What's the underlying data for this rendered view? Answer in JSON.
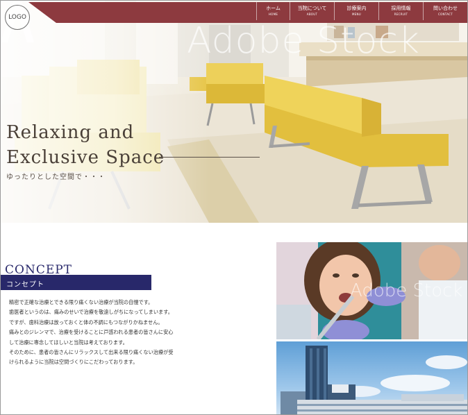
{
  "logo": {
    "text": "LOGO"
  },
  "nav": {
    "items": [
      {
        "jp": "ホーム",
        "en": "HOME"
      },
      {
        "jp": "当院について",
        "en": "ABOUT"
      },
      {
        "jp": "診療案内",
        "en": "MENU"
      },
      {
        "jp": "採用情報",
        "en": "RECRUIT"
      },
      {
        "jp": "問い合わせ",
        "en": "CONTACT"
      }
    ]
  },
  "hero": {
    "title_line1": "Relaxing and",
    "title_line2": "Exclusive Space",
    "subtitle": "ゆったりとした空間で・・・",
    "watermark": "Adobe Stock"
  },
  "concept": {
    "title": "CONCEPT",
    "label": "コンセプト",
    "paragraphs": [
      "精密で正確な治療とできる限り痛くない治療が当院の自慢です。",
      "歯医者というのは、痛みのせいで治療を敬遠しがちになってしまいます。",
      "ですが、歯科治療は放っておくと体の不調にもつながりかねません。",
      "痛みとのジレンマで、治療を受けることに戸惑われる患者の皆さんに安心",
      "して治療に専念してほしいと当院は考えております。",
      "そのために、患者の皆さんにリラックスして出来る限り痛くない治療が受",
      "けられるように当院は空間づくりにこだわっております。"
    ]
  },
  "photos": {
    "dental_watermark": "Adobe Stock"
  },
  "colors": {
    "nav_bg": "#8d3a3f",
    "concept_bar": "#28286a",
    "concept_title": "#2a2a6c",
    "bench": "#e7c64a"
  }
}
